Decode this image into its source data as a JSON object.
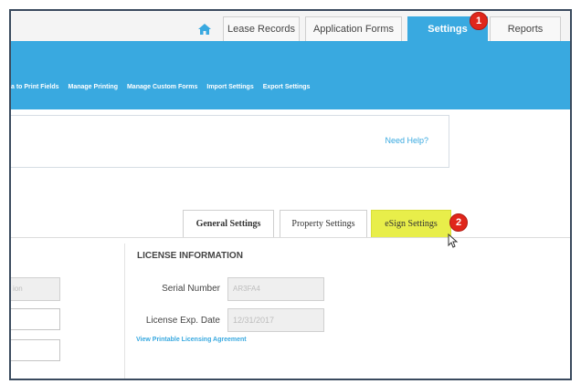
{
  "top_tabs": [
    {
      "label": "Lease Records"
    },
    {
      "label": "Application Forms"
    },
    {
      "label": "Settings",
      "active": true,
      "badge": "1"
    },
    {
      "label": "Reports"
    }
  ],
  "home_icon": "home-icon",
  "sub_nav": [
    {
      "label": "a to Print Fields"
    },
    {
      "label": "Manage Printing"
    },
    {
      "label": "Manage Custom Forms"
    },
    {
      "label": "Import Settings"
    },
    {
      "label": "Export Settings"
    }
  ],
  "help": {
    "label": "Need Help?"
  },
  "settings_tabs": [
    {
      "label": "General Settings"
    },
    {
      "label": "Property Settings"
    },
    {
      "label": "eSign Settings",
      "badge": "2"
    }
  ],
  "left_panel": {
    "field_value": "ion"
  },
  "license": {
    "title": "LICENSE INFORMATION",
    "serial_label": "Serial Number",
    "serial_value": "AR3FA4",
    "exp_label": "License Exp. Date",
    "exp_value": "12/31/2017",
    "agreement_link": "View Printable Licensing Agreement"
  },
  "colors": {
    "accent": "#39a9e0",
    "highlight": "#e8ee4a",
    "badge": "#e0261b"
  }
}
